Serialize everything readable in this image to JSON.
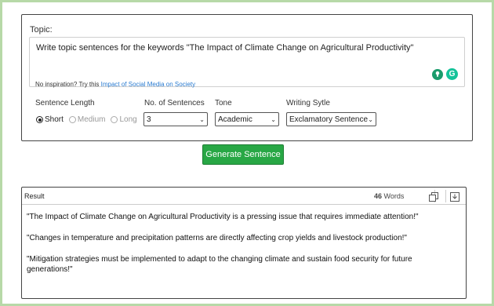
{
  "topic": {
    "label": "Topic:",
    "value": "Write topic sentences for the keywords \"The Impact of Climate Change on Agricultural Productivity\"",
    "inspiration_prefix": "No inspiration? Try this",
    "inspiration_link": "Impact of Social Media on Society"
  },
  "options": {
    "length_label": "Sentence Length",
    "length_options": [
      "Short",
      "Medium",
      "Long"
    ],
    "length_selected": "Short",
    "count_label": "No. of Sentences",
    "count_value": "3",
    "tone_label": "Tone",
    "tone_value": "Academic",
    "style_label": "Writing Sytle",
    "style_value": "Exclamatory Sentence"
  },
  "generate_label": "Generate Sentence",
  "result": {
    "title": "Result",
    "word_count": "46",
    "word_unit": "Words",
    "sentences": [
      "\"The Impact of Climate Change on Agricultural Productivity is a pressing issue that requires immediate attention!\"",
      "\"Changes in temperature and precipitation patterns are directly affecting crop yields and livestock production!\"",
      "\"Mitigation strategies must be implemented to adapt to the changing climate and sustain food security for future generations!\""
    ]
  },
  "colors": {
    "frame": "#b7d9a8",
    "button": "#28a745",
    "link": "#2a7bd0",
    "grammarly": "#15c39a"
  },
  "icons": [
    "lightbulb-icon",
    "grammarly-icon",
    "copy-icon",
    "download-icon",
    "chevron-down-icon"
  ]
}
